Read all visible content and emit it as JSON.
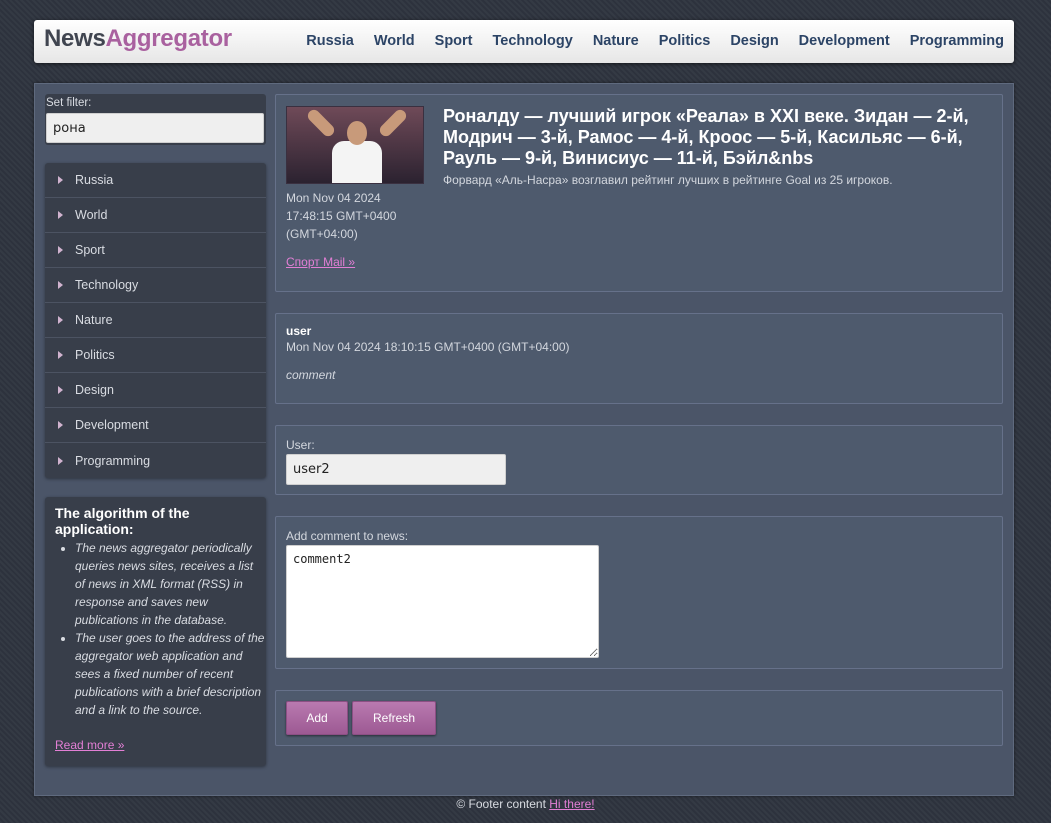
{
  "header": {
    "logo_part1": "News",
    "logo_part2": "Aggregator",
    "nav": [
      "Russia",
      "World",
      "Sport",
      "Technology",
      "Nature",
      "Politics",
      "Design",
      "Development",
      "Programming"
    ]
  },
  "sidebar": {
    "filter_label": "Set filter:",
    "filter_value": "рона",
    "items": [
      "Russia",
      "World",
      "Sport",
      "Technology",
      "Nature",
      "Politics",
      "Design",
      "Development",
      "Programming"
    ],
    "algo": {
      "title": "The algorithm of the application:",
      "points": [
        "The news aggregator periodically queries news sites, receives a list of news in XML format (RSS) in response and saves new publications in the database.",
        "The user goes to the address of the aggregator web application and sees a fixed number of recent publications with a brief description and a link to the source."
      ],
      "read_more": "Read more »"
    }
  },
  "news": {
    "title": "Роналду — лучший игрок «Реала» в XXI веке. Зидан — 2-й, Модрич — 3-й, Рамос — 4-й, Кроос — 5-й, Касильяс — 6-й, Рауль — 9-й, Винисиус — 11-й, Бэйл&nbs",
    "description": "Форвард «Аль-Насра» возглавил рейтинг лучших в рейтинге Goal из 25 игроков.",
    "date": "Mon Nov 04 2024 17:48:15 GMT+0400 (GMT+04:00)",
    "source": "Спорт Mail »"
  },
  "comment": {
    "user": "user",
    "date": "Mon Nov 04 2024 18:10:15 GMT+0400 (GMT+04:00)",
    "text": "comment"
  },
  "form": {
    "user_label": "User:",
    "user_value": "user2",
    "comment_label": "Add comment to news:",
    "comment_value": "comment2",
    "add_label": "Add",
    "refresh_label": "Refresh"
  },
  "footer": {
    "text": "© Footer content",
    "link": "Hi there!"
  }
}
